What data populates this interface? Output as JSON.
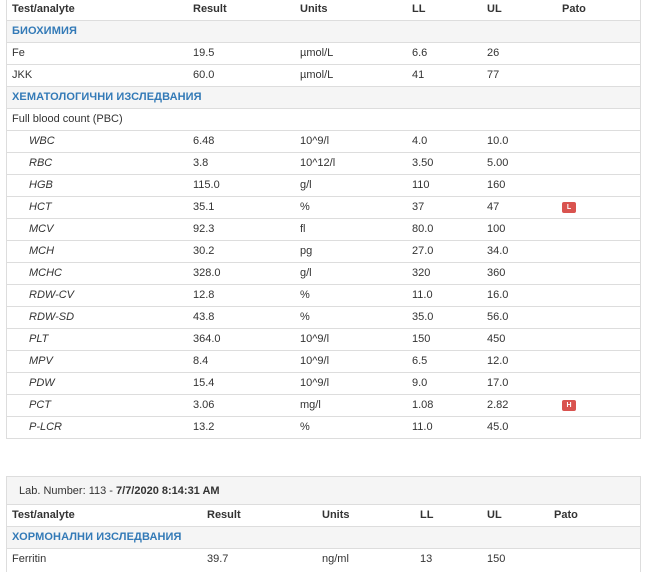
{
  "report1": {
    "headers": [
      "Test/analyte",
      "Result",
      "Units",
      "LL",
      "UL",
      "Pato"
    ],
    "sections": [
      {
        "title": "БИОХИМИЯ",
        "rows": [
          {
            "test": "Fe",
            "result": "19.5",
            "units": "µmol/L",
            "ll": "6.6",
            "ul": "26",
            "pato": ""
          },
          {
            "test": "JKK",
            "result": "60.0",
            "units": "µmol/L",
            "ll": "41",
            "ul": "77",
            "pato": ""
          }
        ]
      },
      {
        "title": "ХЕМАТОЛОГИЧНИ ИЗСЛЕДВАНИЯ",
        "group_label": "Full blood count (PBC)",
        "rows": [
          {
            "test": "WBC",
            "result": "6.48",
            "units": "10^9/l",
            "ll": "4.0",
            "ul": "10.0",
            "pato": ""
          },
          {
            "test": "RBC",
            "result": "3.8",
            "units": "10^12/l",
            "ll": "3.50",
            "ul": "5.00",
            "pato": ""
          },
          {
            "test": "HGB",
            "result": "115.0",
            "units": "g/l",
            "ll": "110",
            "ul": "160",
            "pato": ""
          },
          {
            "test": "HCT",
            "result": "35.1",
            "units": "%",
            "ll": "37",
            "ul": "47",
            "pato": "L"
          },
          {
            "test": "MCV",
            "result": "92.3",
            "units": "fl",
            "ll": "80.0",
            "ul": "100",
            "pato": ""
          },
          {
            "test": "MCH",
            "result": "30.2",
            "units": "pg",
            "ll": "27.0",
            "ul": "34.0",
            "pato": ""
          },
          {
            "test": "MCHC",
            "result": "328.0",
            "units": "g/l",
            "ll": "320",
            "ul": "360",
            "pato": ""
          },
          {
            "test": "RDW-CV",
            "result": "12.8",
            "units": "%",
            "ll": "11.0",
            "ul": "16.0",
            "pato": ""
          },
          {
            "test": "RDW-SD",
            "result": "43.8",
            "units": "%",
            "ll": "35.0",
            "ul": "56.0",
            "pato": ""
          },
          {
            "test": "PLT",
            "result": "364.0",
            "units": "10^9/l",
            "ll": "150",
            "ul": "450",
            "pato": ""
          },
          {
            "test": "MPV",
            "result": "8.4",
            "units": "10^9/l",
            "ll": "6.5",
            "ul": "12.0",
            "pato": ""
          },
          {
            "test": "PDW",
            "result": "15.4",
            "units": "10^9/l",
            "ll": "9.0",
            "ul": "17.0",
            "pato": ""
          },
          {
            "test": "PCT",
            "result": "3.06",
            "units": "mg/l",
            "ll": "1.08",
            "ul": "2.82",
            "pato": "H"
          },
          {
            "test": "P-LCR",
            "result": "13.2",
            "units": "%",
            "ll": "11.0",
            "ul": "45.0",
            "pato": ""
          }
        ]
      }
    ]
  },
  "report2": {
    "lab_prefix": "Lab. Number: 113 - ",
    "lab_datetime": "7/7/2020 8:14:31 AM",
    "headers": [
      "Test/analyte",
      "Result",
      "Units",
      "LL",
      "UL",
      "Pato"
    ],
    "sections": [
      {
        "title": "ХОРМОНАЛНИ ИЗСЛЕДВАНИЯ",
        "rows": [
          {
            "test": "Ferritin",
            "result": "39.7",
            "units": "ng/ml",
            "ll": "13",
            "ul": "150",
            "pato": ""
          }
        ]
      }
    ]
  },
  "colors": {
    "section_text": "#337ab7",
    "flag_bg": "#d9534f",
    "header_bg": "#f5f5f5",
    "border": "#dddddd"
  }
}
